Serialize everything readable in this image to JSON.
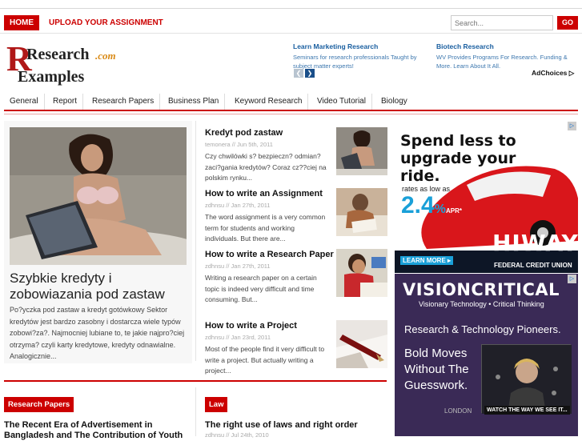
{
  "topbar": {
    "home_label": "HOME",
    "upload_label": "UPLOAD YOUR ASSIGNMENT",
    "search_placeholder": "Search...",
    "go_label": "GO"
  },
  "logo": {
    "line1": "Research",
    "suffix": ".com",
    "line2": "Examples"
  },
  "header_ads": [
    {
      "title": "Learn Marketing Research",
      "desc": "Seminars for research professionals Taught by subject matter experts!"
    },
    {
      "title": "Biotech Research",
      "desc": "WV Provides Programs For Research. Funding & More. Learn About It All."
    }
  ],
  "adchoices_label": "AdChoices",
  "nav": [
    "General",
    "Report",
    "Research Papers",
    "Business Plan",
    "Keyword Research",
    "Video Tutorial",
    "Biology"
  ],
  "feature": {
    "title": "Szybkie kredyty i zobowiazania pod zastaw",
    "excerpt": "Po?yczka pod zastaw a kredyt gotówkowy Sektor kredytów jest bardzo zasobny i dostarcza wiele typów zobowi?za?. Najmocniej lubiane to, te jakie najpro?ciej otrzyma? czyli karty kredytowe, kredyty odnawialne. Analogicznie..."
  },
  "posts": [
    {
      "title": "Kredyt pod zastaw",
      "meta": "temonera // Jun 5th, 2011",
      "excerpt": "Czy chwilówki s? bezpieczn? odmian? zaci?gania kredytów? Coraz cz??ciej na polskim rynku..."
    },
    {
      "title": "How to write an Assignment",
      "meta": "zdhnsu // Jan 27th, 2011",
      "excerpt": "The word assignment is a very common term for students and working individuals. But there are..."
    },
    {
      "title": "How to write a Research Paper",
      "meta": "zdhnsu // Jan 27th, 2011",
      "excerpt": "Writing a research paper on a certain topic is indeed very difficult and time consuming. But..."
    },
    {
      "title": "How to write a Project",
      "meta": "zdhnsu // Jan 23rd, 2011",
      "excerpt": "Most of the people find it very difficult to write a project. But actually writing a project..."
    }
  ],
  "bottom": [
    {
      "category": "Research Papers",
      "title": "The Recent Era of Advertisement in Bangladesh and The Contribution of Youth",
      "meta": ""
    },
    {
      "category": "Law",
      "title": "The right use of laws and right order",
      "meta": "zdhnsu // Jul 24th, 2010"
    }
  ],
  "ad_hiway": {
    "headline": "Spend less to upgrade your ride.",
    "rates_label": "rates as low as",
    "rate_value": "2.4",
    "rate_suffix": "%",
    "apr_label": "APR*",
    "learn_more": "LEARN MORE ▸",
    "brand": "HIWAY",
    "brand_sub": "FEDERAL CREDIT UNION"
  },
  "ad_vision": {
    "brand": "VISIONCRITICAL",
    "tagline": "Visionary Technology • Critical Thinking",
    "headline": "Research & Technology Pioneers.",
    "bold_moves": "Bold Moves Without The Guesswork.",
    "cta": "WATCH THE WAY WE SEE IT...",
    "city": "LONDON"
  },
  "colors": {
    "accent": "#cc0000",
    "link": "#1a5fa0"
  }
}
